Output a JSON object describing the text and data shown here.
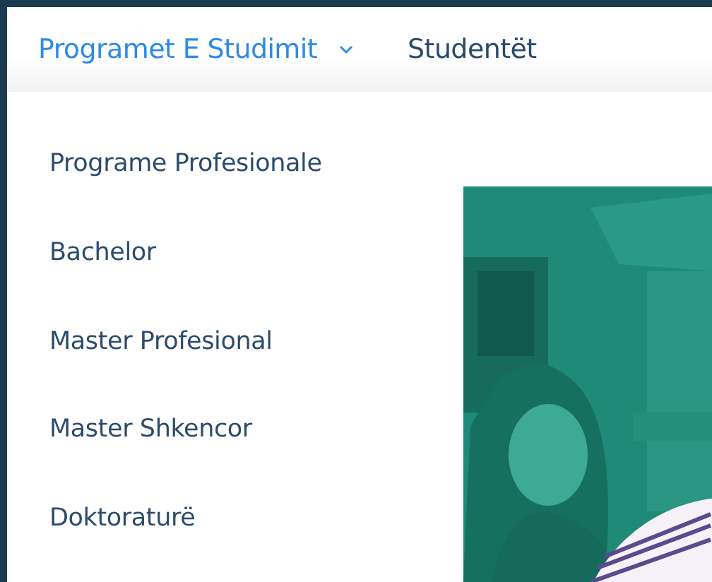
{
  "nav": {
    "items": [
      {
        "label": "Programet E Studimit",
        "selected": true,
        "expanded": true
      },
      {
        "label": "Studentët",
        "selected": false,
        "expanded": false
      }
    ]
  },
  "dropdown": {
    "items": [
      {
        "label": "Programe Profesionale"
      },
      {
        "label": "Bachelor"
      },
      {
        "label": "Master Profesional"
      },
      {
        "label": "Master Shkencor"
      },
      {
        "label": "Doktoraturë"
      }
    ]
  }
}
